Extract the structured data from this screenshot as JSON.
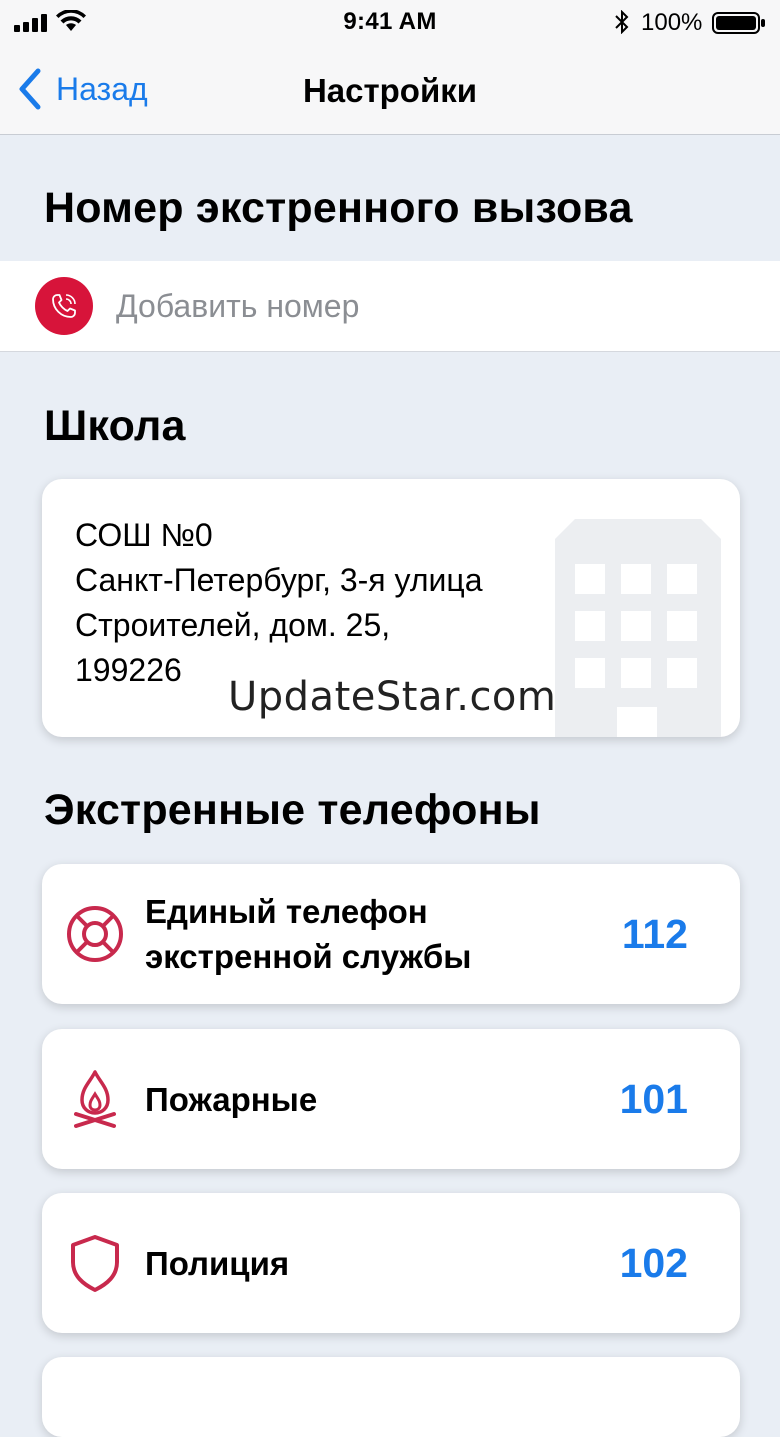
{
  "status_bar": {
    "time": "9:41 AM",
    "battery_percent": "100%",
    "icons": [
      "signal-icon",
      "wifi-icon",
      "bluetooth-icon",
      "battery-icon"
    ]
  },
  "nav": {
    "back_label": "Назад",
    "title": "Настройки"
  },
  "emergency_number": {
    "title": "Номер экстренного вызова",
    "add_label": "Добавить номер",
    "icon": "phone-icon"
  },
  "school": {
    "title": "Школа",
    "name": "СОШ №0",
    "address_line1": "Санкт-Петербург, 3-я улица",
    "address_line2": "Строителей, дом. 25,",
    "postal_code": "199226",
    "icon": "building-icon"
  },
  "watermark": "UpdateStar.com",
  "emergency_phones": {
    "title": "Экстренные телефоны",
    "items": [
      {
        "label_line1": "Единый телефон",
        "label_line2": "экстренной службы",
        "number": "112",
        "icon": "lifebuoy-icon"
      },
      {
        "label_line1": "Пожарные",
        "label_line2": "",
        "number": "101",
        "icon": "fire-icon"
      },
      {
        "label_line1": "Полиция",
        "label_line2": "",
        "number": "102",
        "icon": "shield-icon"
      }
    ]
  },
  "colors": {
    "accent": "#1a7bea",
    "emergency_red": "#d7143a",
    "icon_red": "#c8294d",
    "background": "#e9eef5"
  }
}
